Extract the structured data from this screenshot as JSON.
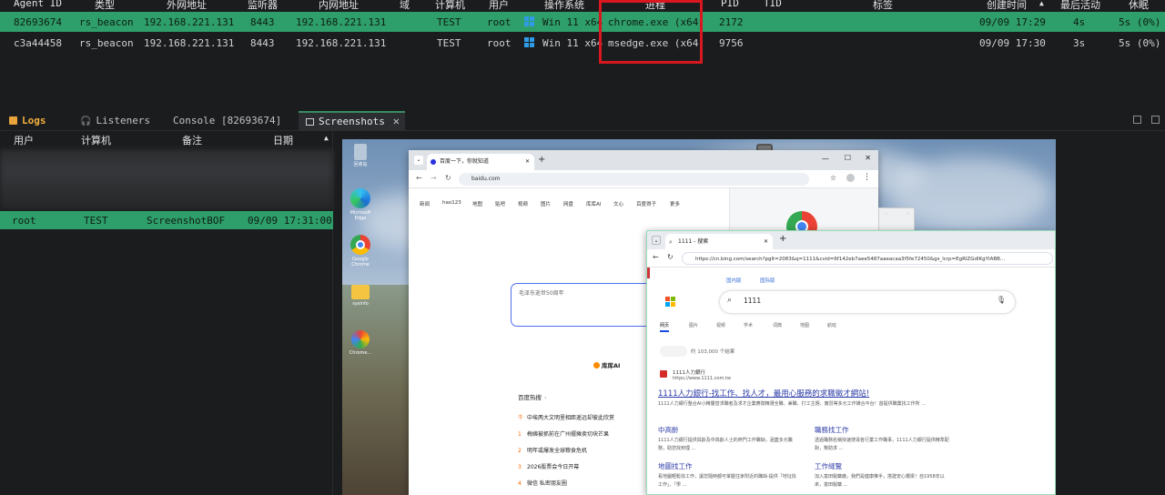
{
  "agent_table": {
    "headers": [
      "Agent ID",
      "类型",
      "外网地址",
      "监听器",
      "内网地址",
      "域",
      "计算机",
      "用户",
      "操作系统",
      "进程",
      "PID",
      "TID",
      "标签",
      "创建时间",
      "最后活动",
      "休眠"
    ],
    "sort_indicator": "▲",
    "rows": [
      {
        "agent_id": "82693674",
        "type": "rs_beacon",
        "external_ip": "192.168.221.131",
        "listener": "8443",
        "internal_ip": "192.168.221.131",
        "domain": "",
        "computer": "TEST",
        "user": "root",
        "os": "Win 11 x64",
        "process": "chrome.exe (x64)",
        "pid": "2172",
        "tid": "",
        "tag": "",
        "created": "09/09 17:29",
        "last_seen": "4s",
        "sleep": "5s (0%)"
      },
      {
        "agent_id": "c3a44458",
        "type": "rs_beacon",
        "external_ip": "192.168.221.131",
        "listener": "8443",
        "internal_ip": "192.168.221.131",
        "domain": "",
        "computer": "TEST",
        "user": "root",
        "os": "Win 11 x64",
        "process": "msedge.exe (x64)",
        "pid": "9756",
        "tid": "",
        "tag": "",
        "created": "09/09 17:30",
        "last_seen": "3s",
        "sleep": "5s (0%)"
      }
    ]
  },
  "tabs": [
    {
      "label": "Logs"
    },
    {
      "label": "Listeners"
    },
    {
      "label": "Console [82693674]"
    },
    {
      "label": "Screenshots",
      "close": "✕"
    }
  ],
  "log_panel": {
    "headers": [
      "用户",
      "计算机",
      "备注",
      "日期"
    ],
    "sort_indicator": "▲",
    "row": {
      "user": "root",
      "computer": "TEST",
      "note": "ScreenshotBOF",
      "date": "09/09 17:31:00"
    }
  },
  "screenshot": {
    "desktop_icons": [
      "回收站",
      "Microsoft Edge",
      "Google Chrome",
      "sysinfo",
      "Chrome..."
    ],
    "baidu": {
      "tab_title": "百度一下，你就知道",
      "url": "baidu.com",
      "nav": [
        "新闻",
        "hao123",
        "地图",
        "贴吧",
        "视频",
        "图片",
        "网盘",
        "库库AI",
        "文心",
        "百度得子",
        "更多"
      ],
      "search_placeholder": "毛泽东逝世50周年",
      "ai_label": "库库AI",
      "hot_title": "百度热搜",
      "hot_items": [
        {
          "n": "千",
          "text": "中埃两大文明里相距遥远却彼此欣赏"
        },
        {
          "n": "1",
          "text": "梅姨被抓前在广州摆摊卖切块芒果"
        },
        {
          "n": "2",
          "text": "明年或爆发全球粮食危机"
        },
        {
          "n": "3",
          "text": "2026股票会今日开幕"
        },
        {
          "n": "4",
          "text": "微信 私密朋友圈"
        }
      ]
    },
    "bing": {
      "tab_title": "1111 - 搜索",
      "url": "https://cn.bing.com/search?pglt=2083&q=1111&cvid=6f142eb7aee5487aaeacaa3f5fe72450&gs_lcrp=EgRlZGdlKgYIABB...",
      "region_tabs": [
        "国内版",
        "国际版"
      ],
      "query": "1111",
      "filters": [
        "网页",
        "图片",
        "视频",
        "学术",
        "词典",
        "地图",
        "航班"
      ],
      "result_count": "约 103,000 个结果",
      "site_name": "1111人力銀行",
      "site_url": "https://www.1111.com.tw",
      "result_title": "1111人力銀行-找工作、找人才，最用心服務的求職徵才網站!",
      "result_desc": "1111人力銀行整合AI小精靈替求職者及求才企業應徵精選全職、兼職、打工主題、實習等多元工作媒合平台！首提供職業找工作所 ...",
      "sublinks": [
        {
          "title": "中高齡",
          "desc": "1111人力銀行提供與齡及中高齡人士的熱門工作職缺，涵蓋多元職務，助您找到理 ..."
        },
        {
          "title": "職務找工作",
          "desc": "透過職務名稱快速搜尋各行業工作職事，1111人力銀行提供精準配對，幫助求 ..."
        },
        {
          "title": "地圖找工作",
          "desc": "看地圖輕鬆找工作，讓您隨時都可掌握住家附近的職缺-提供「地址找工作」、「學 ..."
        },
        {
          "title": "工作縫覽",
          "desc": "加入富田製藥廠，我們是健康推手，搭建安心橋梁！自1958年以來，富田製藥 ..."
        }
      ]
    }
  }
}
